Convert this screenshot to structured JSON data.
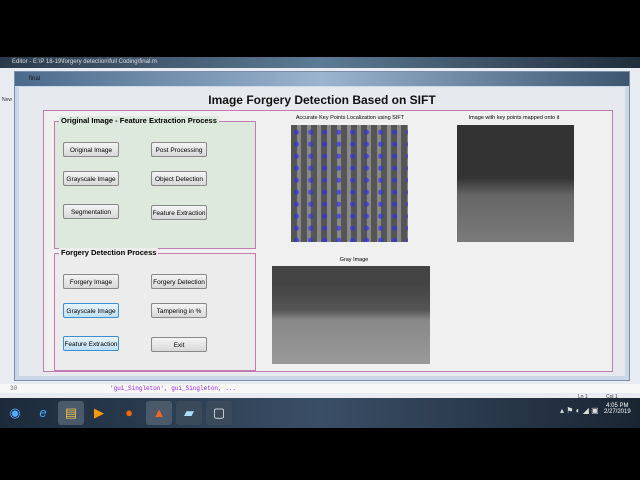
{
  "editor": {
    "title": "Editor - E:\\P 18-19\\forgery detection\\full Coding\\final.m",
    "new_label": "New",
    "line_number": "30",
    "code_line": "'gui_Singleton',  gui_Singleton, ...",
    "status_ln": "Ln 1",
    "status_col": "Col 1"
  },
  "figure": {
    "window_title": "final",
    "heading": "Image Forgery Detection Based on SIFT",
    "panel1": {
      "title": "Original Image - Feature Extraction Process",
      "buttons": [
        "Original Image",
        "Post Processing",
        "Grayscale Image",
        "Object Detection",
        "Segmentation",
        "Feature Extraction"
      ]
    },
    "panel2": {
      "title": "Forgery Detection Process",
      "buttons": [
        "Forgery Image",
        "Forgery Detection",
        "Grayscale Image",
        "Tampering in %",
        "Feature Extraction",
        "Exit"
      ]
    },
    "captions": {
      "sift": "Accurate Key Points Localization using SIFT",
      "mapped": "Image with key points mapped onto it",
      "gray": "Gray Image"
    }
  },
  "taskbar": {
    "time": "4:05 PM",
    "date": "2/27/2019"
  }
}
